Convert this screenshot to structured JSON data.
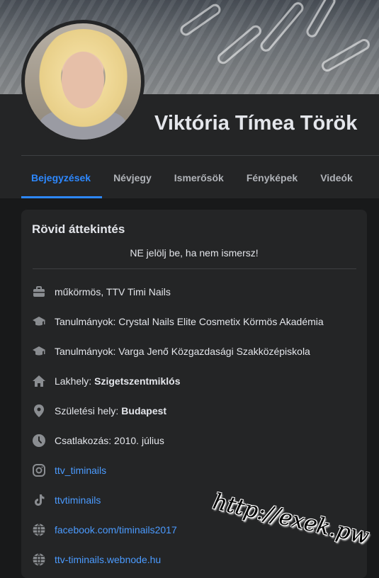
{
  "profile": {
    "name": "Viktória Tímea Török"
  },
  "tabs": [
    "Bejegyzések",
    "Névjegy",
    "Ismerősök",
    "Fényképek",
    "Videók"
  ],
  "intro": {
    "title": "Rövid áttekintés",
    "bio": "NE jelölj be, ha nem ismersz!",
    "items": [
      {
        "icon": "briefcase-icon",
        "text": "műkörmös, TTV Timi Nails",
        "strong": ""
      },
      {
        "icon": "graduation-cap-icon",
        "text": "Tanulmányok: Crystal Nails Elite Cosmetix Körmös Akadémia",
        "strong": ""
      },
      {
        "icon": "graduation-cap-icon",
        "text": "Tanulmányok: Varga Jenő Közgazdasági Szakközépiskola",
        "strong": ""
      },
      {
        "icon": "home-icon",
        "text": "Lakhely:",
        "strong": "Szigetszentmiklós"
      },
      {
        "icon": "location-pin-icon",
        "text": "Születési hely:",
        "strong": "Budapest"
      },
      {
        "icon": "clock-icon",
        "text": "Csatlakozás: 2010. július",
        "strong": ""
      },
      {
        "icon": "instagram-icon",
        "text": "ttv_timinails",
        "strong": ""
      },
      {
        "icon": "tiktok-icon",
        "text": "ttvtiminails",
        "strong": ""
      },
      {
        "icon": "globe-icon",
        "text": "facebook.com/timinails2017",
        "strong": ""
      },
      {
        "icon": "globe-icon",
        "text": "ttv-timinails.webnode.hu",
        "strong": ""
      }
    ]
  },
  "watermark": "http://exek.pw",
  "colors": {
    "accent": "#2d88ff",
    "link": "#4b9bff",
    "background": "#18191a",
    "panel": "#242526"
  }
}
